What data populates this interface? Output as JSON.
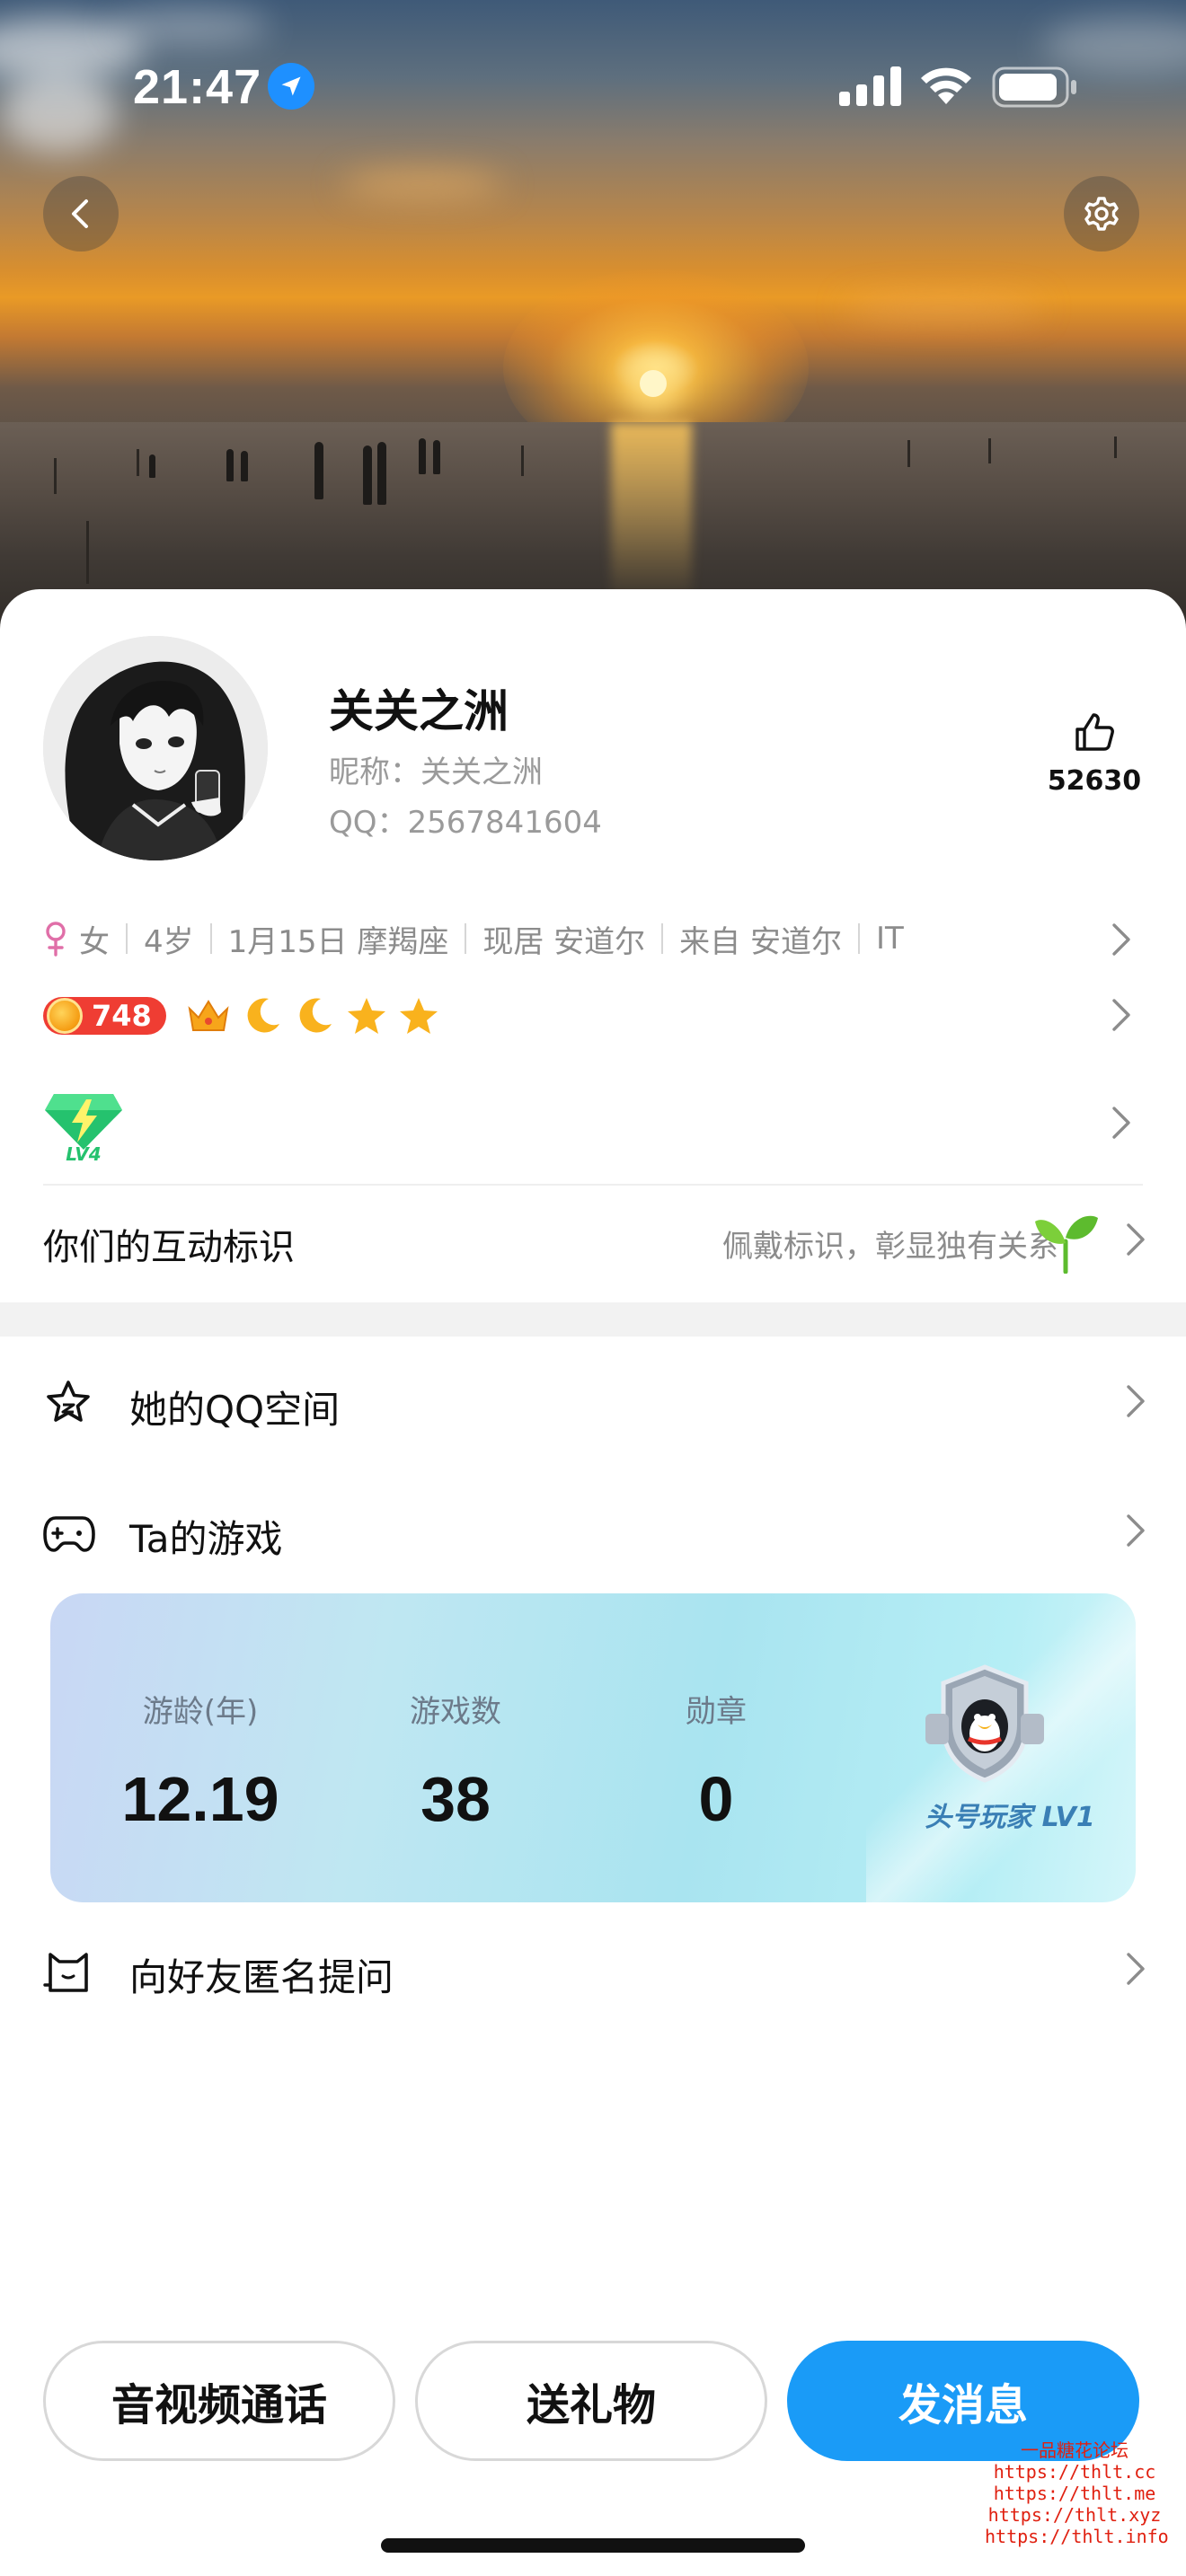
{
  "status_bar": {
    "time": "21:47"
  },
  "profile": {
    "display_name": "关关之洲",
    "nickname": "昵称：关关之洲",
    "qq_number": "QQ：2567841604",
    "likes": "52630"
  },
  "details": {
    "gender": "女",
    "age": "4岁",
    "birthday": "1月15日 摩羯座",
    "current_city": "现居 安道尔",
    "hometown": "来自 安道尔",
    "occupation": "IT"
  },
  "vip": {
    "coin_count": "748"
  },
  "interaction_mark": {
    "title": "你们的互动标识",
    "hint": "佩戴标识，彰显独有关系"
  },
  "menu": {
    "qzone_label": "她的QQ空间",
    "games_label": "Ta的游戏",
    "anonymous_label": "向好友匿名提问"
  },
  "game_card": {
    "stats": [
      {
        "label": "游龄(年)",
        "value": "12.19"
      },
      {
        "label": "游戏数",
        "value": "38"
      },
      {
        "label": "勋章",
        "value": "0"
      }
    ],
    "badge_title": "头号玩家 LV1"
  },
  "actions": {
    "call_label": "音视频通话",
    "gift_label": "送礼物",
    "message_label": "发消息"
  },
  "watermark": {
    "line1": "一品糖花论坛",
    "line2": "https://thlt.cc",
    "line3": "https://thlt.me",
    "line4": "https://thlt.xyz",
    "line5": "https://thlt.info"
  },
  "colors": {
    "accent": "#1a9bf7",
    "coin_badge": "#ef3d33",
    "female_icon": "#e06fa8"
  },
  "icons": {
    "back": "chevron-left-icon",
    "settings": "gear-icon",
    "like": "thumbs-up-icon",
    "qzone": "star-icon",
    "games": "gamepad-icon",
    "anonymous": "cat-icon"
  }
}
